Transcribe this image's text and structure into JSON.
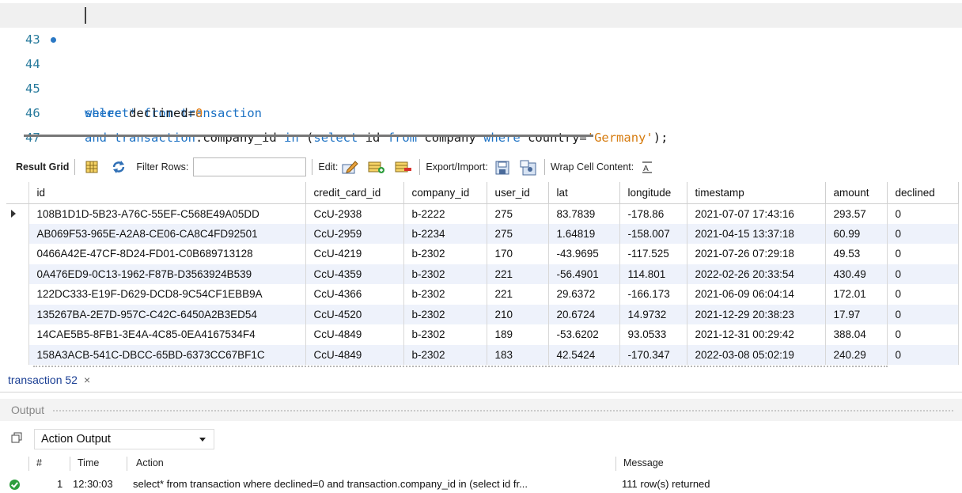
{
  "editor": {
    "lines": [
      {
        "num": "43"
      },
      {
        "num": "44"
      },
      {
        "num": "45"
      },
      {
        "num": "46"
      },
      {
        "num": "47"
      }
    ],
    "tokens": {
      "l44_select": "select*",
      "l44_from": "from",
      "l44_table": "transaction",
      "l45_where": "where",
      "l45_col": "declined=",
      "l45_val": "0",
      "l46_and": "and",
      "l46_tbl": "transaction",
      "l46_col": ".company_id",
      "l46_in": "in",
      "l46_paren": "(",
      "l46_select": "select",
      "l46_id": "id",
      "l46_from": "from",
      "l46_company": "company",
      "l46_where": "where",
      "l46_country": "country=",
      "l46_str": "'Germany'",
      "l46_end": ");"
    }
  },
  "toolbar": {
    "result_grid": "Result Grid",
    "filter_rows": "Filter Rows:",
    "filter_value": "",
    "edit": "Edit:",
    "export_import": "Export/Import:",
    "wrap": "Wrap Cell Content:"
  },
  "grid": {
    "columns": [
      "id",
      "credit_card_id",
      "company_id",
      "user_id",
      "lat",
      "longitude",
      "timestamp",
      "amount",
      "declined"
    ],
    "rows": [
      [
        "108B1D1D-5B23-A76C-55EF-C568E49A05DD",
        "CcU-2938",
        "b-2222",
        "275",
        "83.7839",
        "-178.86",
        "2021-07-07 17:43:16",
        "293.57",
        "0"
      ],
      [
        "AB069F53-965E-A2A8-CE06-CA8C4FD92501",
        "CcU-2959",
        "b-2234",
        "275",
        "1.64819",
        "-158.007",
        "2021-04-15 13:37:18",
        "60.99",
        "0"
      ],
      [
        "0466A42E-47CF-8D24-FD01-C0B689713128",
        "CcU-4219",
        "b-2302",
        "170",
        "-43.9695",
        "-117.525",
        "2021-07-26 07:29:18",
        "49.53",
        "0"
      ],
      [
        "0A476ED9-0C13-1962-F87B-D3563924B539",
        "CcU-4359",
        "b-2302",
        "221",
        "-56.4901",
        "114.801",
        "2022-02-26 20:33:54",
        "430.49",
        "0"
      ],
      [
        "122DC333-E19F-D629-DCD8-9C54CF1EBB9A",
        "CcU-4366",
        "b-2302",
        "221",
        "29.6372",
        "-166.173",
        "2021-06-09 06:04:14",
        "172.01",
        "0"
      ],
      [
        "135267BA-2E7D-957C-C42C-6450A2B3ED54",
        "CcU-4520",
        "b-2302",
        "210",
        "20.6724",
        "14.9732",
        "2021-12-29 20:38:23",
        "17.97",
        "0"
      ],
      [
        "14CAE5B5-8FB1-3E4A-4C85-0EA4167534F4",
        "CcU-4849",
        "b-2302",
        "189",
        "-53.6202",
        "93.0533",
        "2021-12-31 00:29:42",
        "388.04",
        "0"
      ],
      [
        "158A3ACB-541C-DBCC-65BD-6373CC67BF1C",
        "CcU-4849",
        "b-2302",
        "183",
        "42.5424",
        "-170.347",
        "2022-03-08 05:02:19",
        "240.29",
        "0"
      ]
    ]
  },
  "tab": {
    "label": "transaction 52",
    "close": "×"
  },
  "output": {
    "title": "Output",
    "selector": "Action Output",
    "headers": {
      "hash": "#",
      "time": "Time",
      "action": "Action",
      "message": "Message"
    },
    "row": {
      "num": "1",
      "time": "12:30:03",
      "action": "select* from transaction where declined=0  and transaction.company_id in (select id fr...",
      "message": "111 row(s) returned"
    }
  },
  "icons": {
    "grid": "grid-view-icon",
    "refresh": "refresh-icon",
    "edit": "edit-pencil-icon",
    "add_row": "add-row-icon",
    "delete_row": "delete-row-icon",
    "export": "export-icon",
    "import": "import-icon",
    "wrap": "wrap-cell-icon",
    "copy": "copy-icon",
    "status_ok": "success-check-icon"
  },
  "colors": {
    "keyword": "#1d72c4",
    "number": "#e07a10",
    "string": "#d67c10",
    "row_alt": "#eef2fb",
    "tab_text": "#1b3f94",
    "success": "#2e9e3e"
  }
}
